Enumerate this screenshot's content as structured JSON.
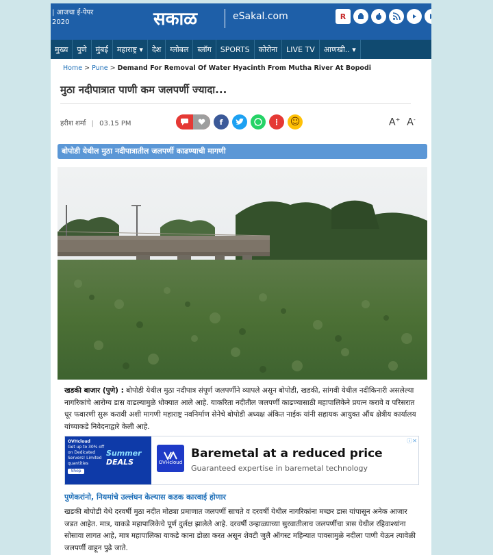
{
  "header": {
    "left_text": "| आजचा ई-पेपर",
    "year": "2020",
    "logo": "सकाळ",
    "esakal": "eSakal.com",
    "social_icons": [
      "r-icon",
      "android-icon",
      "apple-icon",
      "rss-icon",
      "youtube-icon",
      "play-icon"
    ]
  },
  "nav": {
    "items": [
      "मुख्य",
      "पुणे",
      "मुंबई",
      "महाराष्ट्र ▾",
      "देश",
      "ग्लोबल",
      "ब्लॉग",
      "SPORTS",
      "कोरोना",
      "LIVE TV",
      "आणखी.. ▾"
    ]
  },
  "breadcrumb": {
    "home": "Home",
    "sep": ">",
    "section": "Pune",
    "current": "Demand For Removal Of Water Hyacinth From Mutha River At Bopodi"
  },
  "article": {
    "headline": "मुठा नदीपात्रात पाणी कम जलपर्णी ज्यादा...",
    "author": "हरीश शर्मा",
    "time_sep": "|",
    "time": "03.15 PM",
    "font_increase": "A",
    "font_decrease": "A",
    "subhead": "बोपोडी येथील मुठा नदीपात्रातील जलपर्णी काढण्याची मागणी",
    "dateline": "खडकी बाजार (पुणे) :",
    "para1": " बोपोडी येथील मुठा नदीपात्र संपूर्ण जलपर्णीने व्यापले असून बोपोडी, खडकी, सांगवी येथील नदीकिनारी असलेल्या नागरिकांचे आरोग्य डास वाढल्यामुळे धोक्यात आले आहे. याकरिता नदीतील जलपर्णी काढण्यासाठी महापालिकेने प्रयत्न करावे व परिसरात धूर फवारणी सुरू करावी अशी मागणी महाराष्ट्र नवनिर्माण सेनेचे बोपोडी अध्यक्ष अंकित नाईक यांनी सहायक आयुक्त औंध क्षेत्रीय कार्यालय यांच्याकडे निवेदनाद्वारे केली आहे.",
    "section_title": "पुणेकरांनो, नियमांचे उल्लंघन केल्यास कडक कारवाई होणार",
    "para2": "खडकी बोपोडी येथे दरवर्षी मुठा नदीत मोठ्या प्रमाणात जलपर्णी साचते व दरवर्षी येथील नागरिकांना मच्छर डास यांपासून अनेक आजार जडत आहेत. मात्र, याकडे महापालिकेचे पूर्ण दुर्लक्ष झालेले आहे. दरवर्षी उन्हाळ्याच्या सुरवातीलाच जलपर्णीचा त्रास येथील रहिवाश्यांना सोसावा लागत आहे, मात्र महापालिका याकडे काना डोळा करत असून शेवटी जुलै ऑगस्ट महिन्यात पावसामुळे नदीला पाणी येऊन त्यावेळी जलपर्णी वाहून पुढे जाते."
  },
  "ad": {
    "brand_small": "OVHcloud",
    "promo_text": "Get up to 30% off on Dedicated Servers! Limited quantities",
    "promo_button": "Shop",
    "summer": "Summer",
    "deals": "DEALS",
    "logo_text": "OVHcloud",
    "title": "Baremetal at a reduced price",
    "subtitle": "Guaranteed expertise in baremetal technology",
    "adchoice": "ⓘ✕"
  },
  "colors": {
    "header_blue": "#1e5fa8",
    "nav_dark": "#104a70",
    "subhead_blue": "#5b97d6",
    "link_blue": "#1e6fb8",
    "page_bg": "#cfe6ea"
  }
}
